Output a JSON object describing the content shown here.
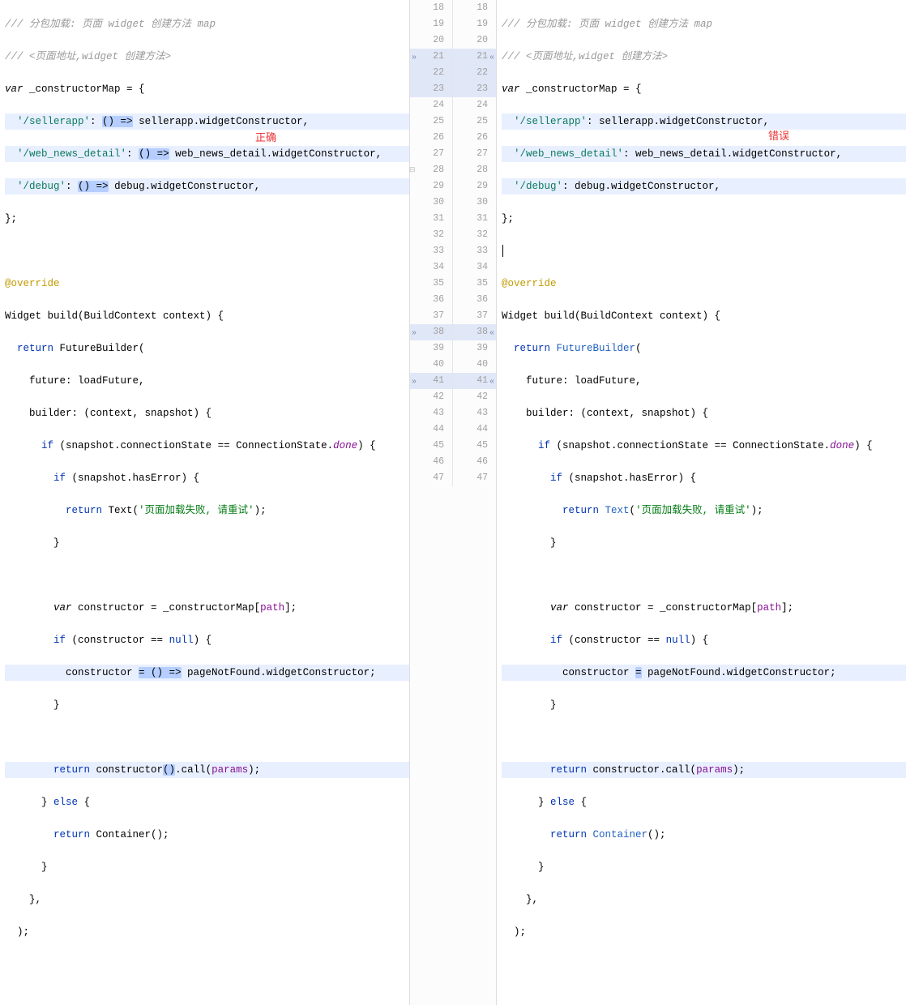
{
  "labels": {
    "correct": "正确",
    "wrong": "错误"
  },
  "lineNumbers": {
    "left": [
      "18",
      "19",
      "20",
      "21",
      "22",
      "23",
      "24",
      "25",
      "26",
      "27",
      "28",
      "29",
      "30",
      "31",
      "32",
      "33",
      "34",
      "35",
      "36",
      "37",
      "38",
      "39",
      "40",
      "41",
      "42",
      "43",
      "44",
      "45",
      "46",
      "47"
    ],
    "right": [
      "18",
      "19",
      "20",
      "21",
      "22",
      "23",
      "24",
      "25",
      "26",
      "27",
      "28",
      "29",
      "30",
      "31",
      "32",
      "33",
      "34",
      "35",
      "36",
      "37",
      "38",
      "39",
      "40",
      "41",
      "42",
      "43",
      "44",
      "45",
      "46",
      "47"
    ]
  },
  "left": {
    "c1": "/// 分包加载: 页面 widget 创建方法 map",
    "c2": "/// <页面地址,widget 创建方法>",
    "l3a": "var",
    "l3b": " _constructorMap = {",
    "l4a": "'/sellerapp'",
    "l4b": ": ",
    "l4c": "() =>",
    "l4d": " sellerapp.widgetConstructor,",
    "l5a": "'/web_news_detail'",
    "l5b": ": ",
    "l5c": "() =>",
    "l5d": " web_news_detail.widgetConstructor,",
    "l6a": "'/debug'",
    "l6b": ": ",
    "l6c": "() =>",
    "l6d": " debug.widgetConstructor,",
    "l7": "};",
    "l9": "@override",
    "l10": "Widget build(BuildContext context) {",
    "l11a": "return",
    "l11b": " FutureBuilder(",
    "l12": "    future: loadFuture,",
    "l13": "    builder: (context, snapshot) {",
    "l14a": "if",
    "l14b": " (snapshot.connectionState == ConnectionState.",
    "l14c": "done",
    "l14d": ") {",
    "l15a": "if",
    "l15b": " (snapshot.hasError) {",
    "l16a": "return",
    "l16b": " Text(",
    "l16c": "'页面加载失败, 请重试'",
    "l16d": ");",
    "l17": "        }",
    "l19a": "var",
    "l19b": " constructor = _constructorMap[",
    "l19c": "path",
    "l19d": "];",
    "l20a": "if",
    "l20b": " (constructor == ",
    "l20c": "null",
    "l20d": ") {",
    "l21a": "          constructor ",
    "l21b": "= () =>",
    "l21c": " pageNotFound.widgetConstructor;",
    "l22": "        }",
    "l24a": "return",
    "l24b": " constructor",
    "l24c": "()",
    "l24d": ".call(",
    "l24e": "params",
    "l24f": ");",
    "l25": "      } ",
    "l25a": "else",
    "l25b": " {",
    "l26a": "return",
    "l26b": " Container();",
    "l27": "      }",
    "l28": "    },",
    "l29": "  );"
  },
  "right": {
    "c1": "/// 分包加载: 页面 widget 创建方法 map",
    "c2": "/// <页面地址,widget 创建方法>",
    "l3a": "var",
    "l3b": " _constructorMap = {",
    "l4a": "'/sellerapp'",
    "l4b": ": sellerapp.widgetConstructor,",
    "l5a": "'/web_news_detail'",
    "l5b": ": web_news_detail.widgetConstructor,",
    "l6a": "'/debug'",
    "l6b": ": debug.widgetConstructor,",
    "l7": "};",
    "l9": "@override",
    "l10": "Widget build(BuildContext context) {",
    "l11a": "return",
    "l11b": " FutureBuilder",
    "l11c": "(",
    "l12": "    future: loadFuture,",
    "l13": "    builder: (context, snapshot) {",
    "l14a": "if",
    "l14b": " (snapshot.connectionState == ConnectionState.",
    "l14c": "done",
    "l14d": ") {",
    "l15a": "if",
    "l15b": " (snapshot.hasError) {",
    "l16a": "return",
    "l16b": " Text",
    "l16c": "(",
    "l16d": "'页面加载失败, 请重试'",
    "l16e": ");",
    "l17": "        }",
    "l19a": "var",
    "l19b": " constructor = _constructorMap[",
    "l19c": "path",
    "l19d": "];",
    "l20a": "if",
    "l20b": " (constructor == ",
    "l20c": "null",
    "l20d": ") {",
    "l21a": "          constructor ",
    "l21b": "=",
    "l21c": " pageNotFound.widgetConstructor;",
    "l22": "        }",
    "l24a": "return",
    "l24b": " constructor.call(",
    "l24c": "params",
    "l24d": ");",
    "l25": "      } ",
    "l25a": "else",
    "l25b": " {",
    "l26a": "return",
    "l26b": " Container",
    "l26c": "();",
    "l27": "      }",
    "l28": "    },",
    "l29": "  );"
  }
}
